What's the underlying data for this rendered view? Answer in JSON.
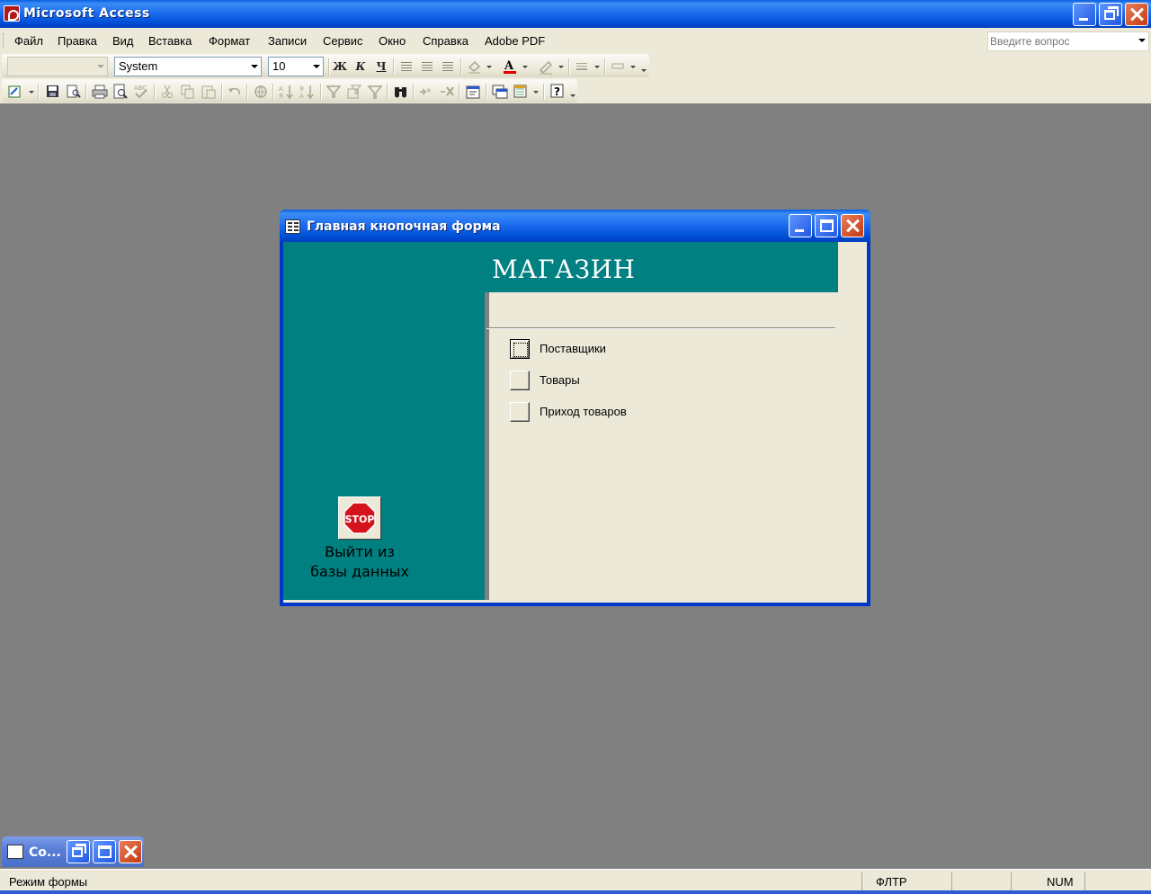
{
  "app": {
    "title": "Microsoft Access"
  },
  "menu": {
    "items": [
      "Файл",
      "Правка",
      "Вид",
      "Вставка",
      "Формат",
      "Записи",
      "Сервис",
      "Окно",
      "Справка",
      "Adobe PDF"
    ],
    "ask_placeholder": "Введите вопрос"
  },
  "formatting_toolbar": {
    "object_value": "",
    "font_value": "System",
    "size_value": "10",
    "bold": "Ж",
    "italic": "К",
    "underline": "Ч"
  },
  "form_window": {
    "title": "Главная кнопочная форма",
    "header": "МАГАЗИН",
    "switchboard_items": [
      {
        "label": "Поставщики"
      },
      {
        "label": "Товары"
      },
      {
        "label": "Приход товаров"
      }
    ],
    "exit_label_line1": "Выйти из",
    "exit_label_line2": "базы данных",
    "stop_text": "STOP",
    "colors": {
      "teal": "#008080",
      "stop_red": "#d4141c",
      "xp_blue": "#0a5ee0"
    }
  },
  "minimized_window": {
    "title": "Co..."
  },
  "status": {
    "mode": "Режим формы",
    "filter": "ФЛТР",
    "num": "NUM"
  }
}
